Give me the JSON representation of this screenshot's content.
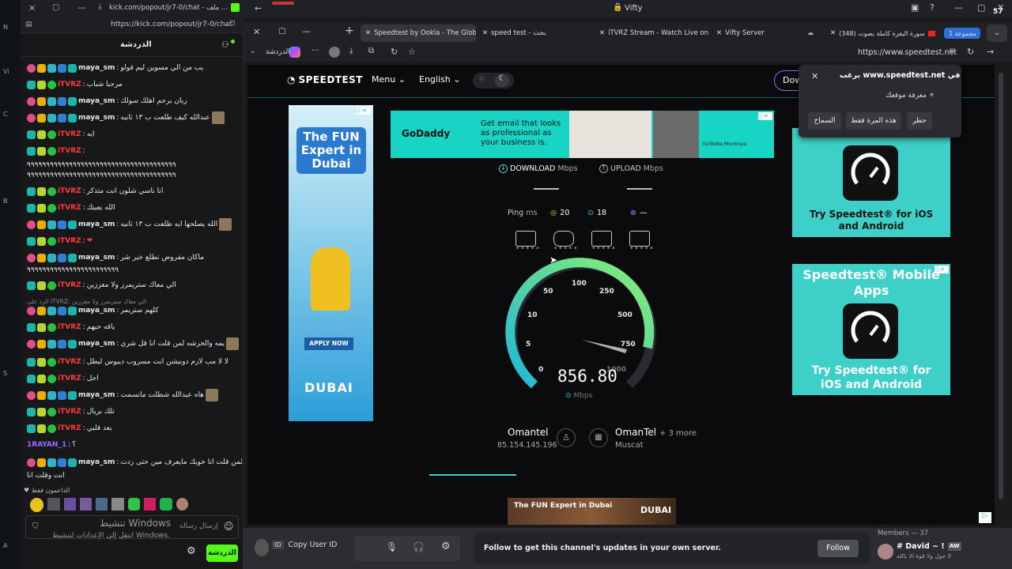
{
  "desktop": {
    "labels": [
      "N",
      "Vi",
      "C",
      "B",
      "S",
      "A"
    ]
  },
  "kick": {
    "tab_title": "kick.com/popout/jr7-0/chat - ملف ...",
    "url": "https://kick.com/popout/jr7-0/chat",
    "header_title": "الدردشة",
    "messages": [
      {
        "user": "maya_sm",
        "text": "يب من الي مسوين ليم قولو",
        "style": "maya"
      },
      {
        "user": "iTVRZ",
        "text": "مرحبا شباب",
        "style": "itv"
      },
      {
        "user": "maya_sm",
        "text": "ربان برحم اهلك سولك",
        "style": "maya"
      },
      {
        "user": "maya_sm",
        "text": "عبدالله كيف طلعت ب ١٣ ثانيه",
        "style": "maya"
      },
      {
        "user": "iTVRZ",
        "text": "ايه",
        "style": "itv"
      },
      {
        "user": "iTVRZ",
        "text": "",
        "style": "itv"
      },
      {
        "user": "",
        "text": "٩٩٩٩٩٩٩٩٩٩٩٩٩٩٩٩٩٩٩٩٩٩٩٩٩٩٩٩٩٩٩٩٩٩٩٩٩٩٩",
        "style": "cont"
      },
      {
        "user": "",
        "text": "٩٩٩٩٩٩٩٩٩٩٩٩٩٩٩٩٩٩٩٩٩٩٩٩٩٩٩٩٩٩٩٩٩٩٩٩٩٩٩",
        "style": "cont"
      },
      {
        "user": "iTVRZ",
        "text": "انا ناسي شلون انت متذكر",
        "style": "itv"
      },
      {
        "user": "iTVRZ",
        "text": "الله يعينك",
        "style": "itv"
      },
      {
        "user": "maya_sm",
        "text": "الله يصلحها ايه طلعت ب ١٣ ثانيه",
        "style": "maya"
      },
      {
        "user": "iTVRZ",
        "text": "❤",
        "style": "itv"
      },
      {
        "user": "maya_sm",
        "text": "ماكان مفروض تطلع خير شر",
        "style": "maya"
      },
      {
        "user": "",
        "text": "٩٩٩٩٩٩٩٩٩٩٩٩٩٩٩٩٩٩٩٩٩٩٩٩",
        "style": "cont"
      },
      {
        "user": "iTVRZ",
        "text": "الي معاك ستريمرز ولا معززين",
        "style": "itv"
      },
      {
        "user": "",
        "text": "الرد على iTVRZ: الي معاك ستريمرز ولا معززين",
        "style": "reply"
      },
      {
        "user": "maya_sm",
        "text": "كلهم ستريمر",
        "style": "maya"
      },
      {
        "user": "iTVRZ",
        "text": "ياقه حيهم",
        "style": "itv"
      },
      {
        "user": "maya_sm",
        "text": "يمه والخرشه لمن قلت انا قل شري",
        "style": "maya"
      },
      {
        "user": "iTVRZ",
        "text": "لا لا مب لازم دونيشن انت مسروب ديبوس لبطل",
        "style": "itv"
      },
      {
        "user": "iTVRZ",
        "text": "اجل",
        "style": "itv"
      },
      {
        "user": "maya_sm",
        "text": "هاه عبدالله شطلت مانسمت",
        "style": "maya"
      },
      {
        "user": "iTVRZ",
        "text": "تلك بريال",
        "style": "itv"
      },
      {
        "user": "iTVRZ",
        "text": "بعد قلبي",
        "style": "itv"
      },
      {
        "user": "1RAYAN_1",
        "text": "؟",
        "style": "ray"
      },
      {
        "user": "maya_sm",
        "text": "لمن قلت انا خويك مايعرف مين حتى ردت",
        "style": "maya"
      },
      {
        "user": "",
        "text": "انت وقلت انا",
        "style": "cont"
      }
    ],
    "supporters_label": "الداعمون فقط",
    "input_placeholder": "إرسال رسالة",
    "windows_activate": "تنشيط Windows",
    "windows_activate_sub": "انتقل إلى الإعدادات لتنشيط Windows.",
    "chat_button": "الدردشة"
  },
  "browser": {
    "window_title": "Vifty",
    "tabs": [
      {
        "label": "Speedtest by Ookla - The Global"
      },
      {
        "label": "speed test - بحث"
      },
      {
        "label": "iTVRZ Stream - Watch Live on K"
      },
      {
        "label": "Vifty Server"
      },
      {
        "label": "سورة البقرة كاملة بصوت (348)"
      },
      {
        "label": "مجموعة 1"
      }
    ],
    "sidebar_label": "الدردشة",
    "url": "https://www.speedtest.net"
  },
  "speedtest": {
    "logo": "SPEEDTEST",
    "menu": "Menu",
    "language": "English",
    "download_btn": "Dow",
    "download_label": "DOWNLOAD",
    "download_unit": "Mbps",
    "upload_label": "UPLOAD",
    "upload_unit": "Mbps",
    "ping_label": "Ping",
    "ping_unit": "ms",
    "ping_idle": "20",
    "ping_down": "18",
    "ping_up": "—",
    "gauge_ticks": [
      "0",
      "5",
      "10",
      "50",
      "100",
      "250",
      "500",
      "750",
      "1000"
    ],
    "current_speed": "856.80",
    "speed_unit": "Mbps",
    "isp": "Omantel",
    "ip": "85.154.145.196",
    "server": "OmanTel",
    "server_more": "+ 3 more",
    "server_city": "Muscat"
  },
  "ads": {
    "godaddy_brand": "GoDaddy",
    "godaddy_text": "Get email that looks as professional as your business is.",
    "godaddy_person": "Yuribdia Montoya",
    "dubai_title": "The FUN Expert in Dubai",
    "dubai_cta": "APPLY NOW",
    "dubai_brand": "DUBAI",
    "st_app_1": "Try Speedtest® for iOS and Android",
    "st_app_2_title": "Speedtest® Mobile Apps",
    "st_app_2": "Try Speedtest® for iOS and Android"
  },
  "permission": {
    "title": "برغب www.speedtest.net في",
    "item": "معرفة موقعك",
    "allow": "السماح",
    "once": "هذه المرة فقط",
    "block": "حظر"
  },
  "discord": {
    "copy_id": "Copy User ID",
    "follow_text": "Follow to get this channel's updates in your own server.",
    "follow_btn": "Follow",
    "members": "Members — 37",
    "member_name": "# David ~ !",
    "member_tag": "AW",
    "member_status": "لا حول ولا قوة الا بالله"
  },
  "tray": {
    "count": "57"
  },
  "colors": {
    "speedtest_accent": "#3ed0c8",
    "kick_green": "#53fc18",
    "itvrz_red": "#ff3b3b"
  }
}
